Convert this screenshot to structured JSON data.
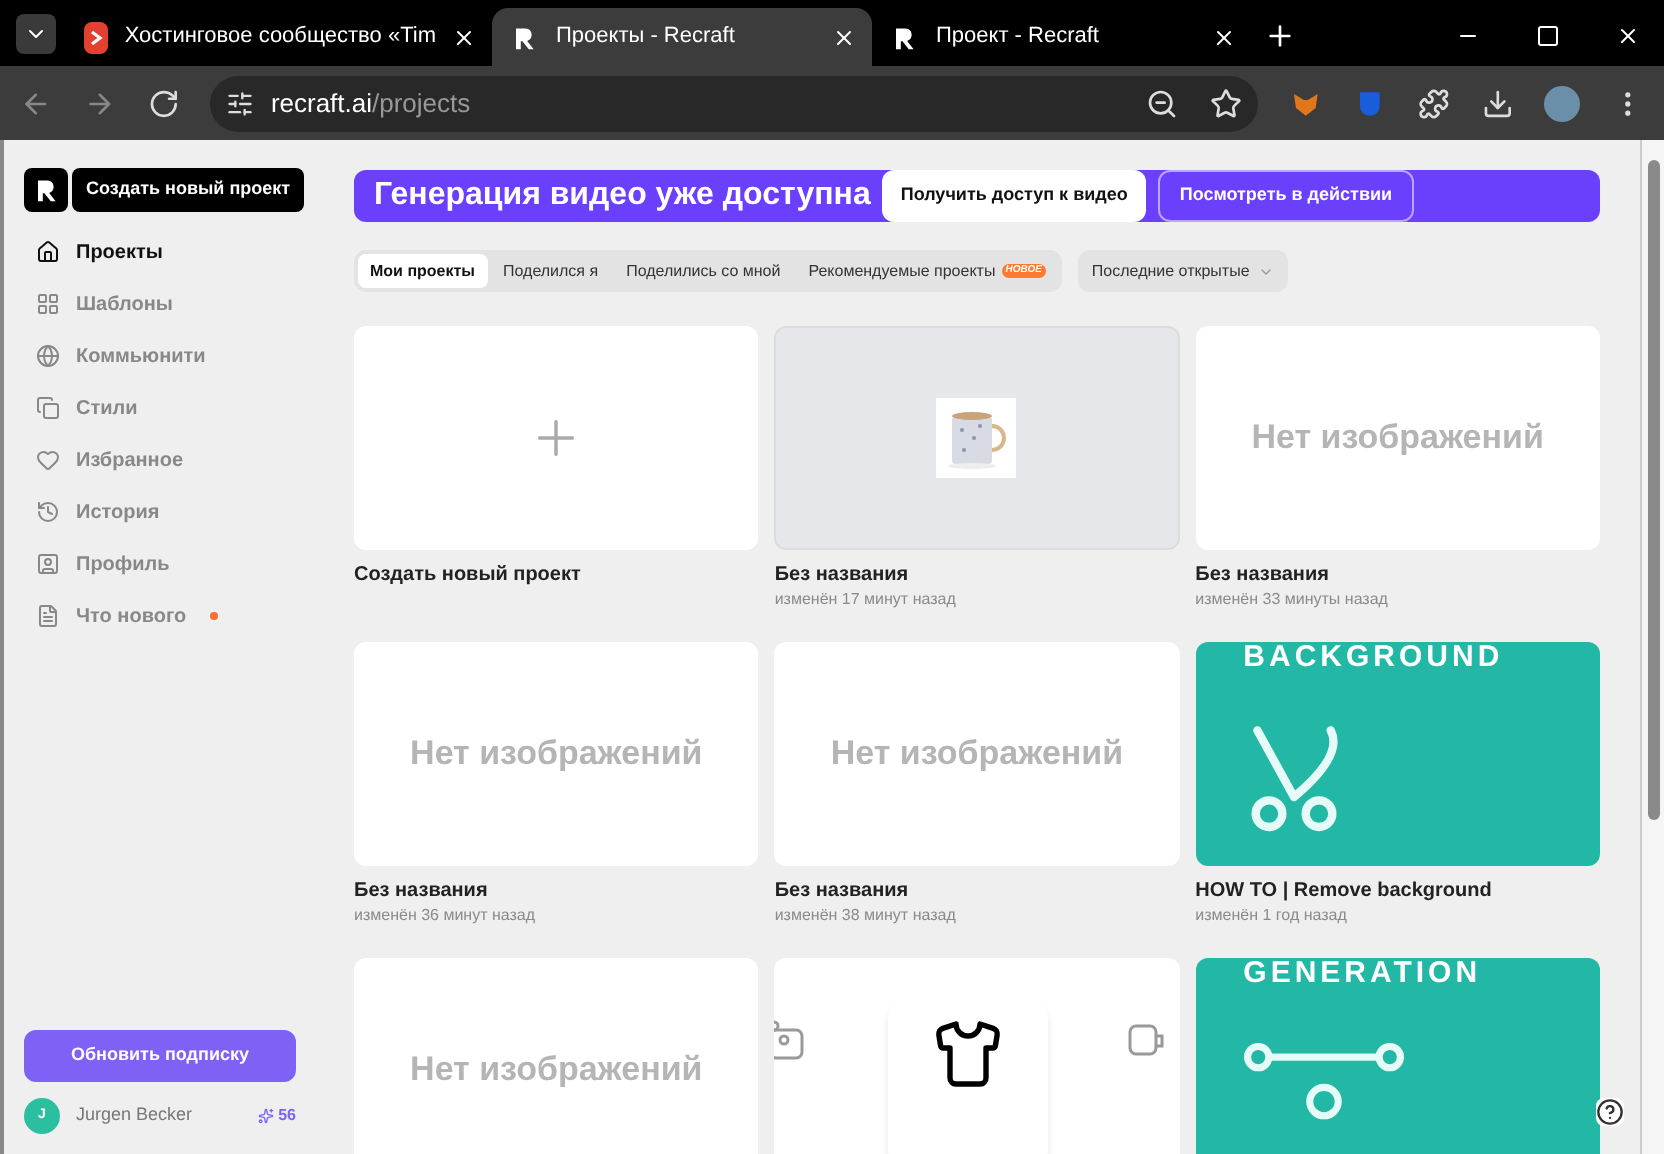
{
  "browser": {
    "tabs": [
      {
        "title": "Хостинговое сообщество «Tim",
        "selected": false,
        "kind": "red"
      },
      {
        "title": "Проекты - Recraft",
        "selected": true,
        "kind": "recraft"
      },
      {
        "title": "Проект - Recraft",
        "selected": false,
        "kind": "recraft"
      }
    ],
    "address": {
      "host": "recraft.ai",
      "path": "/projects"
    }
  },
  "sidebar": {
    "create_button": "Создать новый проект",
    "items": [
      {
        "label": "Проекты",
        "selected": true
      },
      {
        "label": "Шаблоны",
        "selected": false
      },
      {
        "label": "Коммьюнити",
        "selected": false
      },
      {
        "label": "Стили",
        "selected": false
      },
      {
        "label": "Избранное",
        "selected": false
      },
      {
        "label": "История",
        "selected": false
      },
      {
        "label": "Профиль",
        "selected": false
      },
      {
        "label": "Что нового",
        "selected": false,
        "dot": true
      }
    ],
    "upgrade_button": "Обновить подписку",
    "user": {
      "initial": "J",
      "name": "Jurgen Becker",
      "credits": "56"
    }
  },
  "banner": {
    "title": "Генерация видео уже доступна",
    "primary_button": "Получить доступ к видео",
    "secondary_button": "Посмотреть в действии"
  },
  "filter_tabs": [
    {
      "label": "Мои проекты",
      "selected": true
    },
    {
      "label": "Поделился я",
      "selected": false
    },
    {
      "label": "Поделились со мной",
      "selected": false
    },
    {
      "label": "Рекомендуемые проекты",
      "selected": false,
      "badge": "НОВОЕ"
    }
  ],
  "sort": "Последние открытые",
  "projects": [
    {
      "kind": "new",
      "title": "Создать новый проект"
    },
    {
      "title": "Без названия",
      "modified": "изменён 17 минут назад"
    },
    {
      "kind": "empty",
      "placeholder": "Нет изображений",
      "title": "Без названия",
      "modified": "изменён 33 минуты назад"
    },
    {
      "kind": "empty",
      "placeholder": "Нет изображений",
      "title": "Без названия",
      "modified": "изменён 36 минут назад"
    },
    {
      "kind": "empty",
      "placeholder": "Нет изображений",
      "title": "Без названия",
      "modified": "изменён 38 минут назад"
    },
    {
      "kind": "template",
      "heading": "BACKGROUND",
      "title": "HOW TO | Remove background",
      "modified": "изменён 1 год назад"
    },
    {
      "kind": "empty",
      "placeholder": "Нет изображений"
    },
    {
      "kind": "tshirt"
    },
    {
      "kind": "template",
      "heading": "GENERATION"
    }
  ]
}
